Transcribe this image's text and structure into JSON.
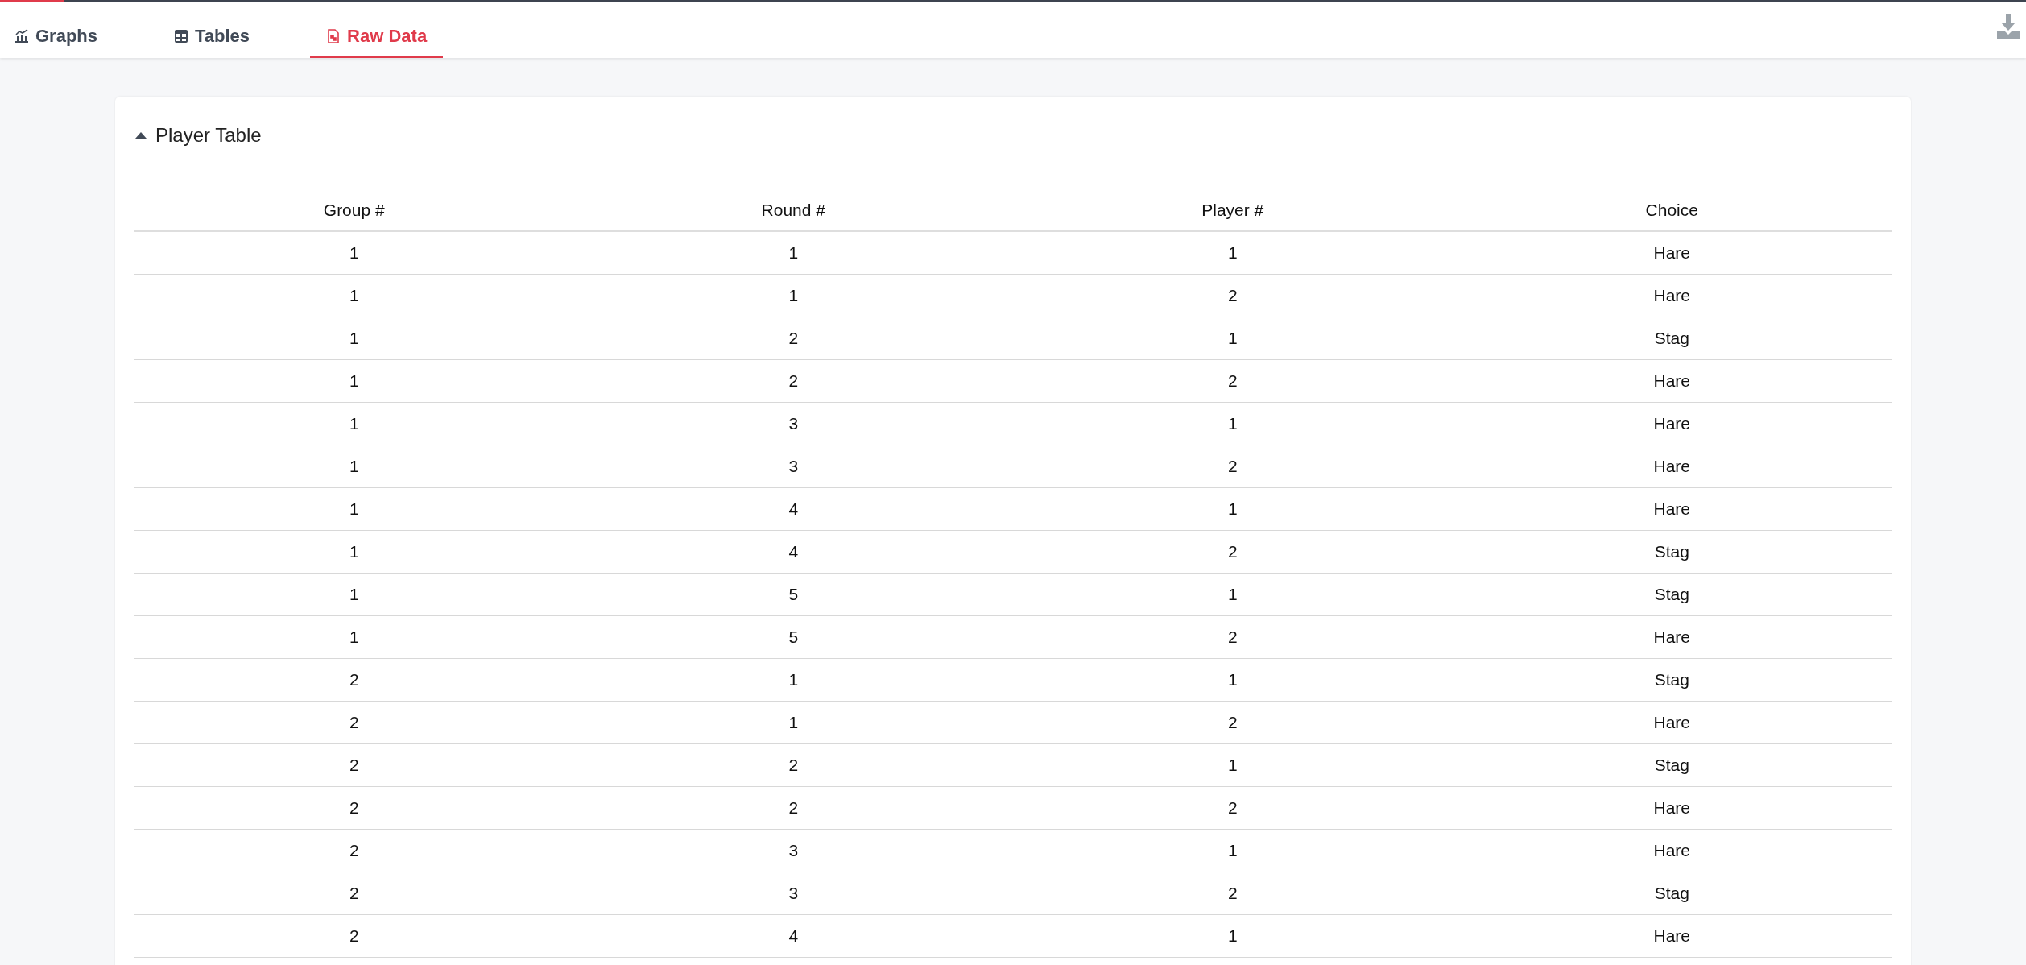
{
  "tabs": [
    {
      "label": "Graphs",
      "selected": false
    },
    {
      "label": "Tables",
      "selected": false
    },
    {
      "label": "Raw Data",
      "selected": true
    }
  ],
  "panel": {
    "title": "Player Table",
    "expanded": true
  },
  "table": {
    "columns": [
      "Group #",
      "Round #",
      "Player #",
      "Choice"
    ],
    "rows": [
      [
        "1",
        "1",
        "1",
        "Hare"
      ],
      [
        "1",
        "1",
        "2",
        "Hare"
      ],
      [
        "1",
        "2",
        "1",
        "Stag"
      ],
      [
        "1",
        "2",
        "2",
        "Hare"
      ],
      [
        "1",
        "3",
        "1",
        "Hare"
      ],
      [
        "1",
        "3",
        "2",
        "Hare"
      ],
      [
        "1",
        "4",
        "1",
        "Hare"
      ],
      [
        "1",
        "4",
        "2",
        "Stag"
      ],
      [
        "1",
        "5",
        "1",
        "Stag"
      ],
      [
        "1",
        "5",
        "2",
        "Hare"
      ],
      [
        "2",
        "1",
        "1",
        "Stag"
      ],
      [
        "2",
        "1",
        "2",
        "Hare"
      ],
      [
        "2",
        "2",
        "1",
        "Stag"
      ],
      [
        "2",
        "2",
        "2",
        "Hare"
      ],
      [
        "2",
        "3",
        "1",
        "Hare"
      ],
      [
        "2",
        "3",
        "2",
        "Stag"
      ],
      [
        "2",
        "4",
        "1",
        "Hare"
      ]
    ]
  }
}
